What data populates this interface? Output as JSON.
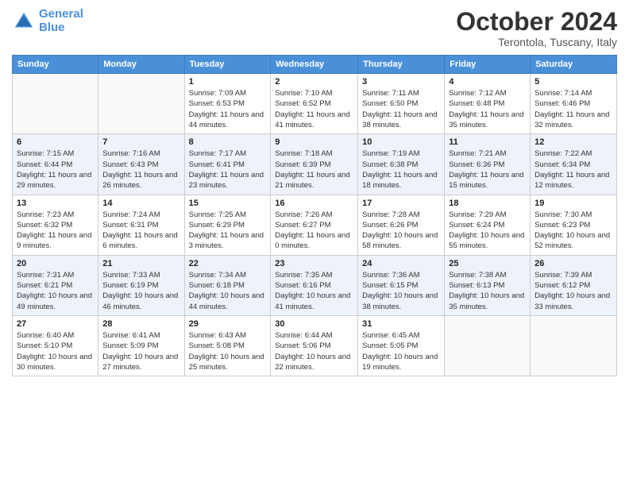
{
  "header": {
    "logo_line1": "General",
    "logo_line2": "Blue",
    "month": "October 2024",
    "location": "Terontola, Tuscany, Italy"
  },
  "days_of_week": [
    "Sunday",
    "Monday",
    "Tuesday",
    "Wednesday",
    "Thursday",
    "Friday",
    "Saturday"
  ],
  "weeks": [
    [
      {
        "day": "",
        "info": ""
      },
      {
        "day": "",
        "info": ""
      },
      {
        "day": "1",
        "info": "Sunrise: 7:09 AM\nSunset: 6:53 PM\nDaylight: 11 hours and 44 minutes."
      },
      {
        "day": "2",
        "info": "Sunrise: 7:10 AM\nSunset: 6:52 PM\nDaylight: 11 hours and 41 minutes."
      },
      {
        "day": "3",
        "info": "Sunrise: 7:11 AM\nSunset: 6:50 PM\nDaylight: 11 hours and 38 minutes."
      },
      {
        "day": "4",
        "info": "Sunrise: 7:12 AM\nSunset: 6:48 PM\nDaylight: 11 hours and 35 minutes."
      },
      {
        "day": "5",
        "info": "Sunrise: 7:14 AM\nSunset: 6:46 PM\nDaylight: 11 hours and 32 minutes."
      }
    ],
    [
      {
        "day": "6",
        "info": "Sunrise: 7:15 AM\nSunset: 6:44 PM\nDaylight: 11 hours and 29 minutes."
      },
      {
        "day": "7",
        "info": "Sunrise: 7:16 AM\nSunset: 6:43 PM\nDaylight: 11 hours and 26 minutes."
      },
      {
        "day": "8",
        "info": "Sunrise: 7:17 AM\nSunset: 6:41 PM\nDaylight: 11 hours and 23 minutes."
      },
      {
        "day": "9",
        "info": "Sunrise: 7:18 AM\nSunset: 6:39 PM\nDaylight: 11 hours and 21 minutes."
      },
      {
        "day": "10",
        "info": "Sunrise: 7:19 AM\nSunset: 6:38 PM\nDaylight: 11 hours and 18 minutes."
      },
      {
        "day": "11",
        "info": "Sunrise: 7:21 AM\nSunset: 6:36 PM\nDaylight: 11 hours and 15 minutes."
      },
      {
        "day": "12",
        "info": "Sunrise: 7:22 AM\nSunset: 6:34 PM\nDaylight: 11 hours and 12 minutes."
      }
    ],
    [
      {
        "day": "13",
        "info": "Sunrise: 7:23 AM\nSunset: 6:32 PM\nDaylight: 11 hours and 9 minutes."
      },
      {
        "day": "14",
        "info": "Sunrise: 7:24 AM\nSunset: 6:31 PM\nDaylight: 11 hours and 6 minutes."
      },
      {
        "day": "15",
        "info": "Sunrise: 7:25 AM\nSunset: 6:29 PM\nDaylight: 11 hours and 3 minutes."
      },
      {
        "day": "16",
        "info": "Sunrise: 7:26 AM\nSunset: 6:27 PM\nDaylight: 11 hours and 0 minutes."
      },
      {
        "day": "17",
        "info": "Sunrise: 7:28 AM\nSunset: 6:26 PM\nDaylight: 10 hours and 58 minutes."
      },
      {
        "day": "18",
        "info": "Sunrise: 7:29 AM\nSunset: 6:24 PM\nDaylight: 10 hours and 55 minutes."
      },
      {
        "day": "19",
        "info": "Sunrise: 7:30 AM\nSunset: 6:23 PM\nDaylight: 10 hours and 52 minutes."
      }
    ],
    [
      {
        "day": "20",
        "info": "Sunrise: 7:31 AM\nSunset: 6:21 PM\nDaylight: 10 hours and 49 minutes."
      },
      {
        "day": "21",
        "info": "Sunrise: 7:33 AM\nSunset: 6:19 PM\nDaylight: 10 hours and 46 minutes."
      },
      {
        "day": "22",
        "info": "Sunrise: 7:34 AM\nSunset: 6:18 PM\nDaylight: 10 hours and 44 minutes."
      },
      {
        "day": "23",
        "info": "Sunrise: 7:35 AM\nSunset: 6:16 PM\nDaylight: 10 hours and 41 minutes."
      },
      {
        "day": "24",
        "info": "Sunrise: 7:36 AM\nSunset: 6:15 PM\nDaylight: 10 hours and 38 minutes."
      },
      {
        "day": "25",
        "info": "Sunrise: 7:38 AM\nSunset: 6:13 PM\nDaylight: 10 hours and 35 minutes."
      },
      {
        "day": "26",
        "info": "Sunrise: 7:39 AM\nSunset: 6:12 PM\nDaylight: 10 hours and 33 minutes."
      }
    ],
    [
      {
        "day": "27",
        "info": "Sunrise: 6:40 AM\nSunset: 5:10 PM\nDaylight: 10 hours and 30 minutes."
      },
      {
        "day": "28",
        "info": "Sunrise: 6:41 AM\nSunset: 5:09 PM\nDaylight: 10 hours and 27 minutes."
      },
      {
        "day": "29",
        "info": "Sunrise: 6:43 AM\nSunset: 5:08 PM\nDaylight: 10 hours and 25 minutes."
      },
      {
        "day": "30",
        "info": "Sunrise: 6:44 AM\nSunset: 5:06 PM\nDaylight: 10 hours and 22 minutes."
      },
      {
        "day": "31",
        "info": "Sunrise: 6:45 AM\nSunset: 5:05 PM\nDaylight: 10 hours and 19 minutes."
      },
      {
        "day": "",
        "info": ""
      },
      {
        "day": "",
        "info": ""
      }
    ]
  ]
}
